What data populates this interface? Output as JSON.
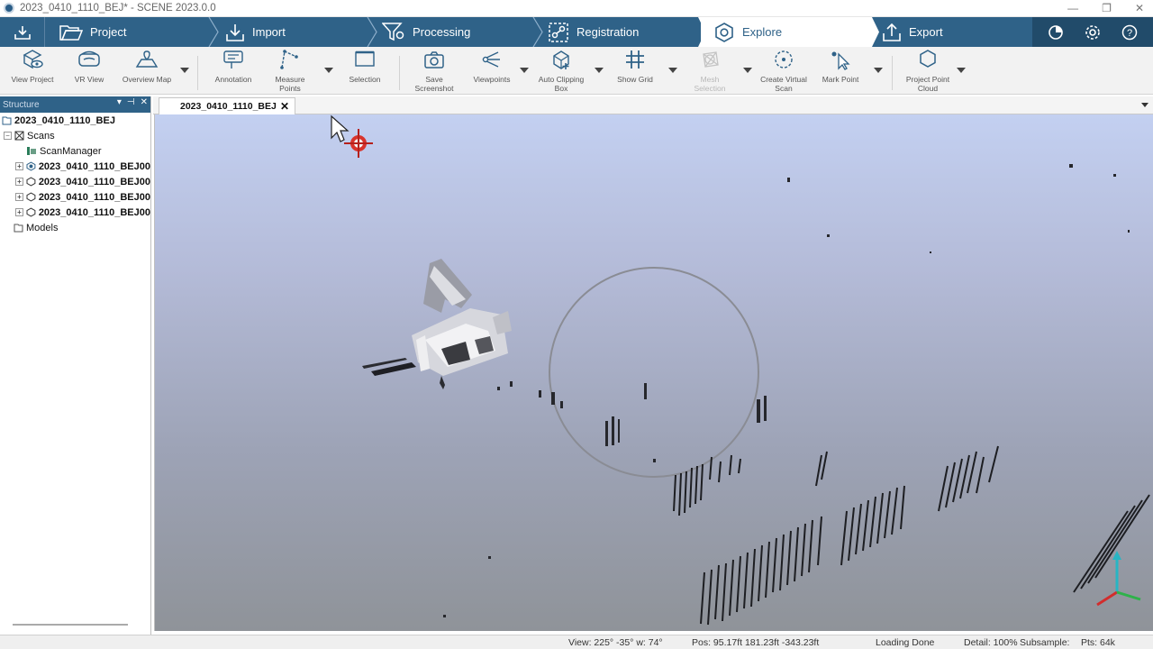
{
  "window": {
    "title": "2023_0410_1110_BEJ* - SCENE 2023.0.0"
  },
  "workflow": {
    "steps": [
      {
        "label": "Project",
        "icon": "folder-open-icon"
      },
      {
        "label": "Import",
        "icon": "import-icon"
      },
      {
        "label": "Processing",
        "icon": "filter-gear-icon"
      },
      {
        "label": "Registration",
        "icon": "registration-icon"
      },
      {
        "label": "Explore",
        "icon": "explore-hexagon-icon",
        "active": true
      },
      {
        "label": "Export",
        "icon": "export-icon"
      }
    ],
    "accent": "#2f6288",
    "dark_accent": "#214b6a"
  },
  "toolbar": {
    "tools": [
      {
        "label": "View Project",
        "icon": "view-project-icon"
      },
      {
        "label": "VR View",
        "icon": "vr-headset-icon"
      },
      {
        "label": "Overview Map",
        "icon": "overview-map-icon"
      },
      {
        "label": "Annotation",
        "icon": "annotation-icon"
      },
      {
        "label": "Measure\nPoints",
        "icon": "measure-points-icon"
      },
      {
        "label": "Selection",
        "icon": "selection-icon"
      },
      {
        "label": "Save\nScreenshot",
        "icon": "camera-icon"
      },
      {
        "label": "Viewpoints",
        "icon": "viewpoints-icon"
      },
      {
        "label": "Auto Clipping\nBox",
        "icon": "clipping-box-icon"
      },
      {
        "label": "Show Grid",
        "icon": "grid-icon"
      },
      {
        "label": "Mesh\nSelection",
        "icon": "mesh-selection-icon",
        "disabled": true
      },
      {
        "label": "Create Virtual\nScan",
        "icon": "virtual-scan-icon"
      },
      {
        "label": "Mark Point",
        "icon": "mark-point-icon"
      },
      {
        "label": "Project Point\nCloud",
        "icon": "project-point-cloud-icon"
      }
    ]
  },
  "structure": {
    "title": "Structure",
    "root": "2023_0410_1110_BEJ",
    "scans_label": "Scans",
    "scan_manager": "ScanManager",
    "scans": [
      "2023_0410_1110_BEJ00",
      "2023_0410_1110_BEJ00",
      "2023_0410_1110_BEJ00",
      "2023_0410_1110_BEJ00"
    ],
    "models_label": "Models"
  },
  "document": {
    "tab_label": "2023_0410_1110_BEJ",
    "close_glyph": "✕"
  },
  "status": {
    "view": "View: 225° -35° w: 74°",
    "pos": "Pos: 95.17ft 181.23ft -343.23ft",
    "loading": "Loading Done",
    "detail": "Detail: 100%",
    "subsample": "Subsample:",
    "pts": "Pts: 64k"
  }
}
